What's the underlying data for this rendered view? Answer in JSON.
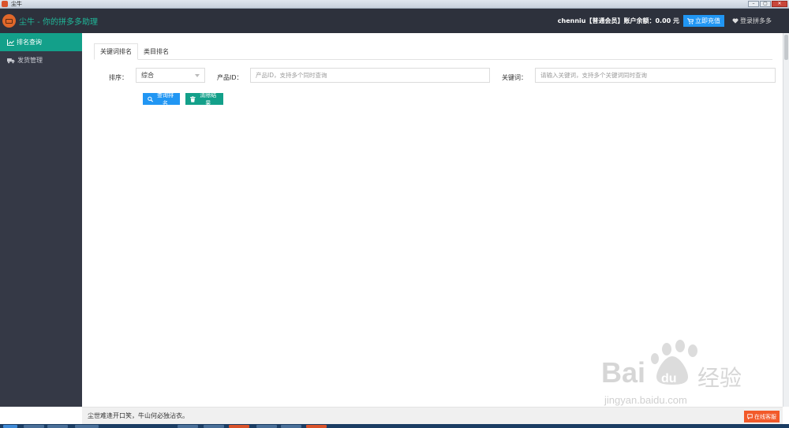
{
  "os_window": {
    "title": "尘牛",
    "controls": [
      "–",
      "▢",
      "✕"
    ]
  },
  "header": {
    "brand": "尘牛 - 你的拼多多助理",
    "user_info": "chenniu【普通会员】账户余额：0.00 元",
    "recharge_label": "立即充值",
    "login_label": "登录拼多多"
  },
  "sidebar": {
    "items": [
      {
        "label": "排名查询",
        "icon": "chart-line-icon",
        "active": true
      },
      {
        "label": "发货管理",
        "icon": "truck-icon",
        "active": false
      }
    ]
  },
  "tabs": [
    {
      "label": "关键词排名",
      "active": true
    },
    {
      "label": "类目排名",
      "active": false
    }
  ],
  "form": {
    "sort_label": "排序：",
    "sort_value": "综合",
    "product_label": "产品ID：",
    "product_placeholder": "产品ID，支持多个同时查询",
    "keyword_label": "关键词：",
    "keyword_placeholder": "请输入关键词，支持多个关键词同时查询",
    "query_button": "查询排名",
    "clear_button": "清除结果"
  },
  "footer": {
    "text": "尘世难逢开口笑，牛山何必独沾衣。",
    "service_button": "在线客服"
  },
  "watermark": {
    "brand": "Bai",
    "brand_cn": "经验",
    "url": "jingyan.baidu.com"
  },
  "colors": {
    "header_bg": "#2d313c",
    "sidebar_bg": "#353946",
    "accent_teal": "#13a08a",
    "accent_blue": "#2196f3",
    "accent_orange": "#f25a2a"
  }
}
